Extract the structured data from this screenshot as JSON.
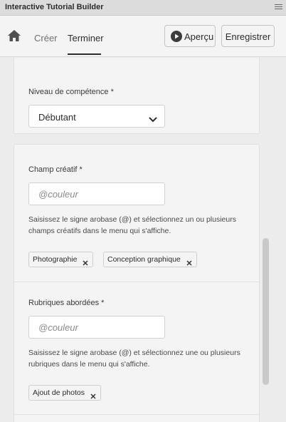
{
  "window": {
    "title": "Interactive Tutorial Builder",
    "menu_icon": "hamburger-icon"
  },
  "nav": {
    "home_icon": "home-icon",
    "tabs": [
      {
        "label": "Créer",
        "active": false
      },
      {
        "label": "Terminer",
        "active": true
      }
    ],
    "preview_label": "Aperçu",
    "preview_icon": "play-circle-icon",
    "save_label": "Enregistrer"
  },
  "skill": {
    "label": "Niveau de compétence *",
    "value": "Débutant"
  },
  "creative_field": {
    "label": "Champ créatif *",
    "placeholder": "@couleur",
    "help": "Saisissez le signe arobase (@) et sélectionnez un ou plusieurs champs créatifs dans le menu qui s'affiche.",
    "tags": [
      "Photographie",
      "Conception graphique"
    ]
  },
  "topics": {
    "label": "Rubriques abordées *",
    "placeholder": "@couleur",
    "help": "Saisissez le signe arobase (@) et sélectionnez une ou plusieurs rubriques dans le menu qui s'affiche.",
    "tags": [
      "Ajout de photos"
    ]
  }
}
